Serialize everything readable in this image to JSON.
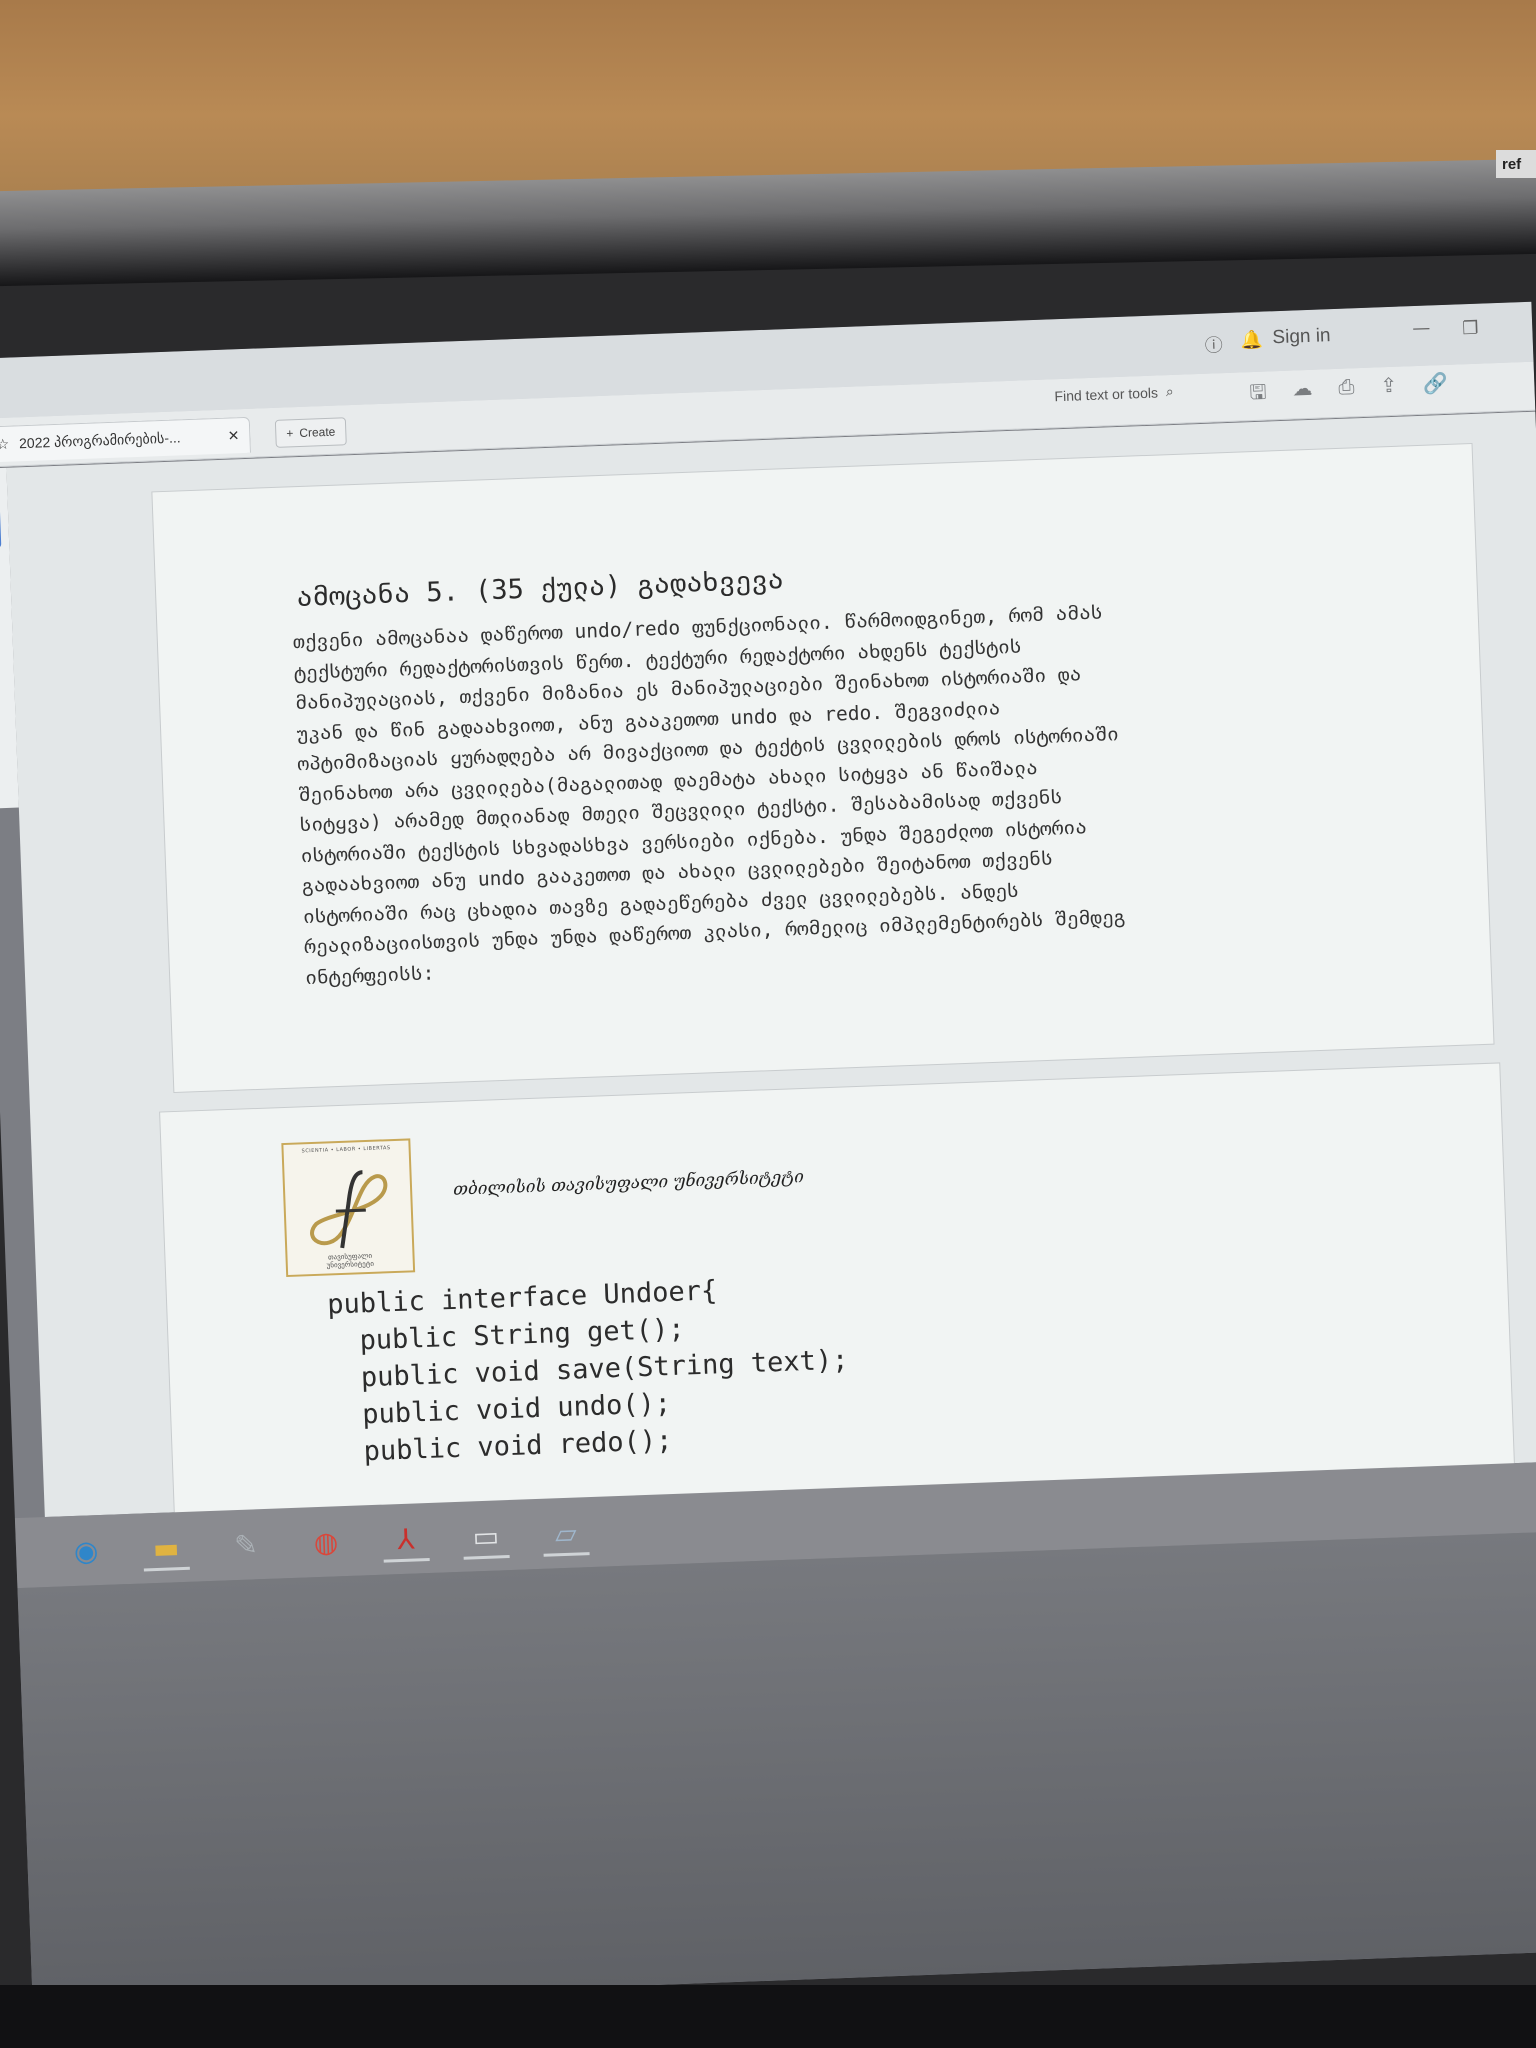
{
  "scrap_text": "ref",
  "window": {
    "sign_in": "Sign in",
    "tab_title": "2022 პროგრამირების-...",
    "create_label": "Create",
    "find_placeholder": "Find text or tools"
  },
  "document": {
    "heading": "ამოცანა 5. (35 ქულა) გადახვევა",
    "paragraph_lines": [
      "თქვენი ამოცანაა დაწეროთ undo/redo ფუნქციონალი. წარმოიდგინეთ, რომ ამას",
      "ტექსტური რედაქტორისთვის წერთ. ტექტური რედაქტორი ახდენს ტექსტის",
      "მანიპულაციას, თქვენი მიზანია ეს მანიპულაციები შეინახოთ ისტორიაში და",
      "უკან და წინ გადაახვიოთ, ანუ გააკეთოთ undo და redo. შეგვიძლია",
      "ოპტიმიზაციას ყურადღება არ მივაქციოთ და ტექტის ცვლილების დროს ისტორიაში",
      "შეინახოთ არა ცვლილება(მაგალითად დაემატა ახალი სიტყვა ან წაიშალა",
      "სიტყვა) არამედ მთლიანად მთელი შეცვლილი ტექსტი. შესაბამისად თქვენს",
      "ისტორიაში ტექსტის სხვადასხვა ვერსიები იქნება. უნდა შეგეძლოთ ისტორია",
      "გადაახვიოთ ანუ undo გააკეთოთ და ახალი ცვლილებები შეიტანოთ თქვენს",
      "ისტორიაში რაც ცხადია თავზე გადაეწერება ძველ ცვლილებებს. ანდეს",
      "რეალიზაციისთვის უნდა უნდა დაწეროთ კლასი, რომელიც იმპლემენტირებს შემდეგ",
      "ინტერფეისს:"
    ],
    "university_name": "თბილისის თავისუფალი უნივერსიტეტი",
    "logo_motto": "SCIENTIA • LABOR • LIBERTAS",
    "logo_bottom_text": [
      "თავისუფალი",
      "უნივერსიტეტი"
    ],
    "code_lines": [
      "public interface Undoer{",
      "public String get();",
      "public void save(String text);",
      "public void undo();",
      "public void redo();"
    ]
  },
  "icons": {
    "help": "question-circle-icon",
    "bell": "bell-icon",
    "search": "search-icon",
    "save": "save-icon",
    "upload": "upload-cloud-icon",
    "print": "print-icon",
    "share": "share-icon",
    "link": "link-icon"
  }
}
